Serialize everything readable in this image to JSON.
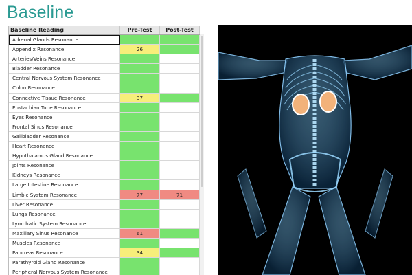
{
  "title": "Baseline",
  "headers": {
    "reading": "Baseline Reading",
    "pre": "Pre-Test",
    "post": "Post-Test"
  },
  "colors": {
    "green": "#78e36e",
    "yellow": "#f7ee7a",
    "red": "#f08a82",
    "accent": "#2a9a92"
  },
  "rows": [
    {
      "name": "Adrenal Glands Resonance",
      "pre": "",
      "post": "",
      "pre_color": "green",
      "post_color": "green"
    },
    {
      "name": "Appendix Resonance",
      "pre": "26",
      "post": "",
      "pre_color": "yellow",
      "post_color": "green"
    },
    {
      "name": "Arteries/Veins Resonance",
      "pre": "",
      "post": "",
      "pre_color": "green",
      "post_color": "white"
    },
    {
      "name": "Bladder Resonance",
      "pre": "",
      "post": "",
      "pre_color": "green",
      "post_color": "white"
    },
    {
      "name": "Central Nervous System  Resonance",
      "pre": "",
      "post": "",
      "pre_color": "green",
      "post_color": "white"
    },
    {
      "name": "Colon Resonance",
      "pre": "",
      "post": "",
      "pre_color": "green",
      "post_color": "white"
    },
    {
      "name": "Connective Tissue Resonance",
      "pre": "37",
      "post": "",
      "pre_color": "yellow",
      "post_color": "green"
    },
    {
      "name": "Eustachian Tube Resonance",
      "pre": "",
      "post": "",
      "pre_color": "green",
      "post_color": "white"
    },
    {
      "name": "Eyes Resonance",
      "pre": "",
      "post": "",
      "pre_color": "green",
      "post_color": "white"
    },
    {
      "name": "Frontal Sinus Resonance",
      "pre": "",
      "post": "",
      "pre_color": "green",
      "post_color": "white"
    },
    {
      "name": "Gallbladder Resonance",
      "pre": "",
      "post": "",
      "pre_color": "green",
      "post_color": "white"
    },
    {
      "name": "Heart Resonance",
      "pre": "",
      "post": "",
      "pre_color": "green",
      "post_color": "white"
    },
    {
      "name": "Hypothalamus Gland Resonance",
      "pre": "",
      "post": "",
      "pre_color": "green",
      "post_color": "white"
    },
    {
      "name": "Joints Resonance",
      "pre": "",
      "post": "",
      "pre_color": "green",
      "post_color": "white"
    },
    {
      "name": "Kidneys Resonance",
      "pre": "",
      "post": "",
      "pre_color": "green",
      "post_color": "white"
    },
    {
      "name": "Large Intestine Resonance",
      "pre": "",
      "post": "",
      "pre_color": "green",
      "post_color": "white"
    },
    {
      "name": "Limbic System Resonance",
      "pre": "77",
      "post": "71",
      "pre_color": "red",
      "post_color": "red"
    },
    {
      "name": "Liver Resonance",
      "pre": "",
      "post": "",
      "pre_color": "green",
      "post_color": "white"
    },
    {
      "name": "Lungs Resonance",
      "pre": "",
      "post": "",
      "pre_color": "green",
      "post_color": "white"
    },
    {
      "name": "Lymphatic System Resonance",
      "pre": "",
      "post": "",
      "pre_color": "green",
      "post_color": "white"
    },
    {
      "name": "Maxillary Sinus Resonance",
      "pre": "61",
      "post": "",
      "pre_color": "red",
      "post_color": "green"
    },
    {
      "name": "Muscles Resonance",
      "pre": "",
      "post": "",
      "pre_color": "green",
      "post_color": "white"
    },
    {
      "name": "Pancreas Resonance",
      "pre": "34",
      "post": "",
      "pre_color": "yellow",
      "post_color": "green"
    },
    {
      "name": "Parathyroid Gland Resonance",
      "pre": "",
      "post": "",
      "pre_color": "green",
      "post_color": "white"
    },
    {
      "name": "Peripheral Nervous System Resonance",
      "pre": "",
      "post": "",
      "pre_color": "green",
      "post_color": "white"
    }
  ],
  "selected_row": 0,
  "figure": {
    "subject": "x-ray-human-body-kidneys-highlighted"
  }
}
